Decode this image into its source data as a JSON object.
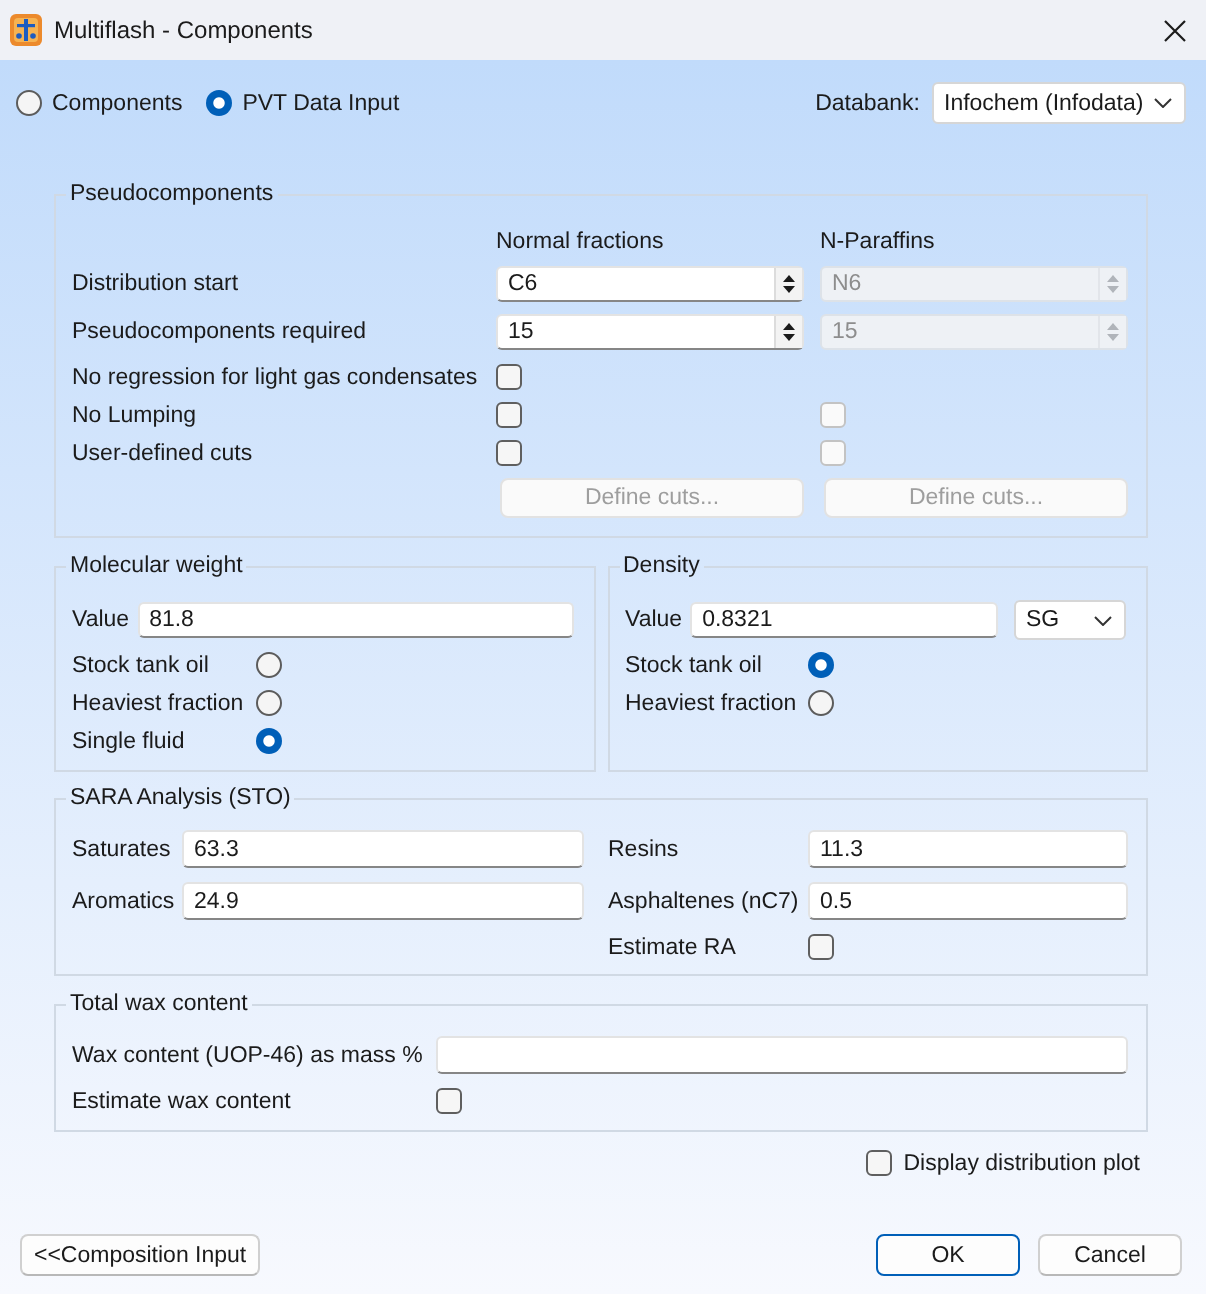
{
  "window": {
    "title": "Multiflash - Components"
  },
  "mode": [
    {
      "label": "Components",
      "selected": false
    },
    {
      "label": "PVT Data Input",
      "selected": true
    }
  ],
  "databank": {
    "label": "Databank:",
    "value": "Infochem (Infodata)"
  },
  "pseudocomponents": {
    "title": "Pseudocomponents",
    "columns": [
      "Normal fractions",
      "N-Paraffins"
    ],
    "rows": [
      {
        "kind": "spinner",
        "label": "Distribution start",
        "cells": [
          {
            "value": "C6",
            "disabled": false
          },
          {
            "value": "N6",
            "disabled": true
          }
        ]
      },
      {
        "kind": "spinner",
        "label": "Pseudocomponents required",
        "cells": [
          {
            "value": "15",
            "disabled": false
          },
          {
            "value": "15",
            "disabled": true
          }
        ]
      },
      {
        "kind": "checkbox",
        "label": "No regression for light gas condensates",
        "cells": [
          {
            "checked": false,
            "disabled": false
          }
        ]
      },
      {
        "kind": "checkbox",
        "label": "No Lumping",
        "cells": [
          {
            "checked": false,
            "disabled": false
          },
          {
            "checked": false,
            "disabled": true
          }
        ]
      },
      {
        "kind": "checkbox",
        "label": "User-defined cuts",
        "cells": [
          {
            "checked": false,
            "disabled": false
          },
          {
            "checked": false,
            "disabled": true
          }
        ]
      },
      {
        "kind": "button",
        "cells": [
          {
            "label": "Define cuts...",
            "disabled": true
          },
          {
            "label": "Define cuts...",
            "disabled": true
          }
        ]
      }
    ]
  },
  "molecular_weight": {
    "title": "Molecular weight",
    "value_label": "Value",
    "value": "81.8",
    "options": [
      {
        "label": "Stock tank oil",
        "selected": false
      },
      {
        "label": "Heaviest fraction",
        "selected": false
      },
      {
        "label": "Single fluid",
        "selected": true
      }
    ]
  },
  "density": {
    "title": "Density",
    "value_label": "Value",
    "value": "0.8321",
    "unit": "SG",
    "options": [
      {
        "label": "Stock tank oil",
        "selected": true
      },
      {
        "label": "Heaviest fraction",
        "selected": false
      }
    ]
  },
  "sara": {
    "title": "SARA Analysis (STO)",
    "fields": [
      {
        "label": "Saturates",
        "value": "63.3"
      },
      {
        "label": "Resins",
        "value": "11.3"
      },
      {
        "label": "Aromatics",
        "value": "24.9"
      },
      {
        "label": "Asphaltenes (nC7)",
        "value": "0.5"
      }
    ],
    "estimate": {
      "label": "Estimate RA",
      "checked": false
    }
  },
  "wax": {
    "title": "Total wax content",
    "field": {
      "label": "Wax content (UOP-46) as mass %"
    },
    "estimate": {
      "label": "Estimate wax content",
      "checked": false
    }
  },
  "display_plot": {
    "label": "Display distribution plot",
    "checked": false
  },
  "buttons": [
    {
      "kind": "back",
      "label": "<<Composition Input"
    },
    {
      "kind": "default",
      "label": "OK"
    },
    {
      "kind": "normal",
      "label": "Cancel"
    }
  ]
}
